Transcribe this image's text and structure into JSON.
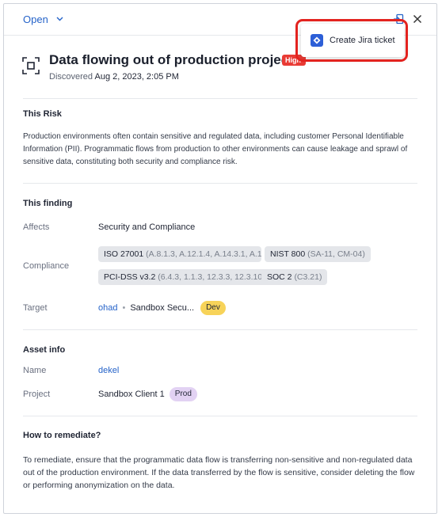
{
  "topbar": {
    "status_label": "Open",
    "export_icon": "export-icon",
    "close_icon": "close-icon"
  },
  "popover": {
    "jira_label": "Create Jira ticket",
    "jira_icon": "jira-icon"
  },
  "header": {
    "title": "Data flowing out of production project",
    "severity": "High",
    "discovered_label": "Discovered",
    "discovered_date": "Aug 2, 2023, 2:05 PM"
  },
  "risk": {
    "title": "This Risk",
    "text": "Production environments often contain sensitive and regulated data, including customer Personal Identifiable Information (PII). Programmatic flows from production to other environments can cause leakage and sprawl of sensitive data, constituting both security and compliance risk."
  },
  "finding": {
    "title": "This finding",
    "affects_label": "Affects",
    "affects_value": "Security and Compliance",
    "compliance_label": "Compliance",
    "compliance": [
      {
        "name": "ISO 27001",
        "controls": "(A.8.1.3, A.12.1.4, A.14.3.1, A.1..."
      },
      {
        "name": "NIST 800",
        "controls": "(SA-11, CM-04)"
      },
      {
        "name": "PCI-DSS v3.2",
        "controls": "(6.4.3, 1.1.3, 12.3.3, 12.3.10)"
      },
      {
        "name": "SOC 2",
        "controls": "(C3.21)"
      }
    ],
    "target_label": "Target",
    "target_name": "ohad",
    "target_project": "Sandbox Secu...",
    "target_tag": "Dev"
  },
  "asset": {
    "title": "Asset info",
    "name_label": "Name",
    "name_value": "dekel",
    "project_label": "Project",
    "project_value": "Sandbox Client 1",
    "project_tag": "Prod"
  },
  "remediate": {
    "title": "How to remediate?",
    "text": "To remediate, ensure that the programmatic data flow is transferring non-sensitive and non-regulated data out of the production environment. If the data transferred by the flow is sensitive, consider deleting the flow or performing anonymization on the data."
  },
  "colors": {
    "accent": "#2563c9",
    "severity_high": "#e93b35",
    "highlight_box": "#e3231f",
    "dev_tag": "#f7d359",
    "prod_tag": "#e2d2f3"
  }
}
